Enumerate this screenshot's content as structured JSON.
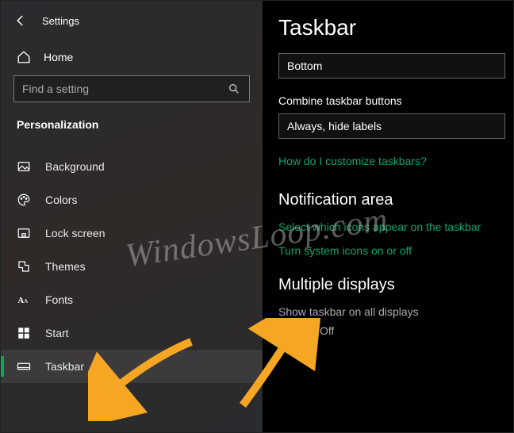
{
  "header": {
    "title": "Settings"
  },
  "sidebar": {
    "home_label": "Home",
    "search_placeholder": "Find a setting",
    "section_label": "Personalization",
    "items": [
      {
        "label": "Background"
      },
      {
        "label": "Colors"
      },
      {
        "label": "Lock screen"
      },
      {
        "label": "Themes"
      },
      {
        "label": "Fonts"
      },
      {
        "label": "Start"
      },
      {
        "label": "Taskbar"
      }
    ]
  },
  "content": {
    "page_title": "Taskbar",
    "position_value": "Bottom",
    "combine_label": "Combine taskbar buttons",
    "combine_value": "Always, hide labels",
    "customize_link": "How do I customize taskbars?",
    "notification_heading": "Notification area",
    "select_icons_link": "Select which icons appear on the taskbar",
    "system_icons_link": "Turn system icons on or off",
    "multiple_displays_heading": "Multiple displays",
    "show_taskbar_all_label": "Show taskbar on all displays",
    "toggle_state": "Off"
  },
  "watermark": "WindowsLoop.com"
}
